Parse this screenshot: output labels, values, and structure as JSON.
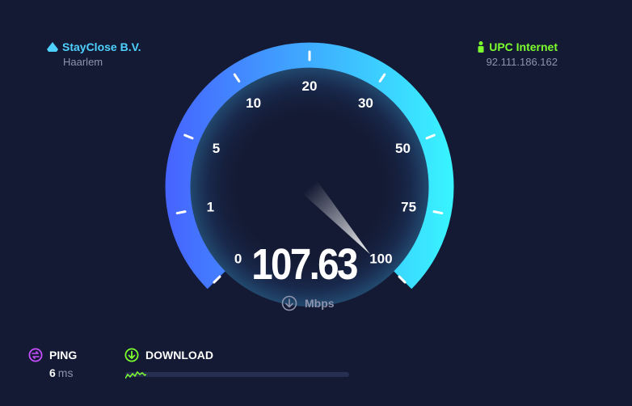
{
  "server": {
    "name": "StayClose B.V.",
    "location": "Haarlem",
    "icon": "server-icon",
    "color": "#4fd1ff"
  },
  "isp": {
    "name": "UPC Internet",
    "ip": "92.111.186.162",
    "icon": "person-icon",
    "color": "#7cff2e"
  },
  "gauge": {
    "scale_labels": [
      "0",
      "1",
      "5",
      "10",
      "20",
      "30",
      "50",
      "75",
      "100"
    ],
    "speed": "107.63",
    "speed_value": 107.63,
    "unit": "Mbps",
    "unit_icon": "download-arrow-icon",
    "gradient_start": "#4663ff",
    "gradient_end": "#38f5ff"
  },
  "ping": {
    "label": "PING",
    "value": "6",
    "unit": "ms",
    "icon": "ping-icon",
    "color": "#c44fff"
  },
  "download": {
    "label": "DOWNLOAD",
    "icon": "download-icon",
    "color": "#7cff2e",
    "progress": 0.1
  }
}
